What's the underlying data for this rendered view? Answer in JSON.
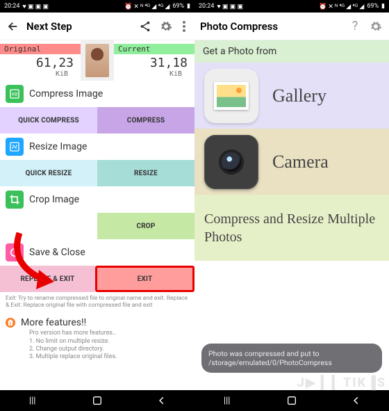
{
  "status": {
    "time": "20:24",
    "battery": "69%"
  },
  "left": {
    "title": "Next Step",
    "size": {
      "original_label": "Original",
      "original_value": "61,23",
      "current_label": "Current",
      "current_value": "31,18",
      "unit": "KiB"
    },
    "sections": {
      "compress": "Compress Image",
      "resize": "Resize Image",
      "crop": "Crop Image",
      "save": "Save & Close",
      "more": "More features!!"
    },
    "buttons": {
      "quick_compress": "QUICK COMPRESS",
      "compress": "COMPRESS",
      "quick_resize": "QUICK RESIZE",
      "resize": "RESIZE",
      "crop": "CROP",
      "replace_exit": "REPLACE & EXIT",
      "exit": "EXIT"
    },
    "hint": "Exit: Try to rename compressed file to original name and exit. Replace & Exit: Replace original file with compressed file and exit",
    "more_sub": "Pro version has more features..\n1. No limit on multiple resize.\n2. Change output directory.\n3. Multiple replace original files."
  },
  "right": {
    "title": "Photo Compress",
    "header": "Get a Photo from",
    "tiles": {
      "gallery": "Gallery",
      "camera": "Camera",
      "multi": "Compress and Resize Multiple Photos"
    },
    "toast": "Photo was compressed and put to /storage/emulated/0/PhotoCompress"
  }
}
